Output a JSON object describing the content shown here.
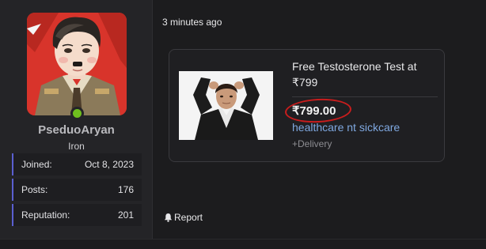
{
  "user": {
    "username": "PseduoAryan",
    "rank": "Iron",
    "stats": [
      {
        "label": "Joined:",
        "value": "Oct 8, 2023"
      },
      {
        "label": "Posts:",
        "value": "176"
      },
      {
        "label": "Reputation:",
        "value": "201"
      }
    ],
    "online_color": "#6fbf1e"
  },
  "post": {
    "timestamp": "3 minutes ago",
    "embed": {
      "title": "Free Testosterone Test at ₹799",
      "price": "₹799.00",
      "store": "healthcare nt sickcare",
      "delivery": "+Delivery"
    },
    "report_label": "Report"
  },
  "colors": {
    "accent": "#5a5fd0",
    "link": "#7fa8e0",
    "annotation_red": "#c81d1d"
  }
}
